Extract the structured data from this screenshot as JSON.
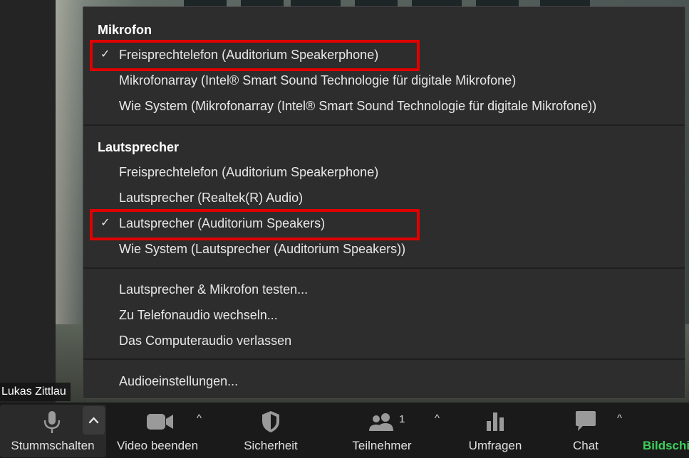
{
  "participant_name": "Lukas Zittlau",
  "menu": {
    "mic_heading": "Mikrofon",
    "mic_items": [
      {
        "label": "Freisprechtelefon (Auditorium Speakerphone)",
        "checked": true
      },
      {
        "label": "Mikrofonarray (Intel® Smart Sound Technologie für digitale Mikrofone)",
        "checked": false
      },
      {
        "label": "Wie System (Mikrofonarray (Intel® Smart Sound Technologie für digitale Mikrofone))",
        "checked": false
      }
    ],
    "speaker_heading": "Lautsprecher",
    "speaker_items": [
      {
        "label": "Freisprechtelefon (Auditorium Speakerphone)",
        "checked": false
      },
      {
        "label": "Lautsprecher (Realtek(R) Audio)",
        "checked": false
      },
      {
        "label": "Lautsprecher (Auditorium Speakers)",
        "checked": true
      },
      {
        "label": "Wie System (Lautsprecher (Auditorium Speakers))",
        "checked": false
      }
    ],
    "actions": [
      "Lautsprecher & Mikrofon testen...",
      "Zu Telefonaudio wechseln...",
      "Das Computeraudio verlassen"
    ],
    "settings": "Audioeinstellungen...",
    "check_glyph": "✓"
  },
  "toolbar": {
    "mute": "Stummschalten",
    "video": "Video beenden",
    "security": "Sicherheit",
    "participants": "Teilnehmer",
    "participants_count": "1",
    "polls": "Umfragen",
    "chat": "Chat",
    "share": "Bildschi",
    "caret_glyph": "^",
    "accent_green": "#3dd05a",
    "highlight_red": "#e00000"
  }
}
